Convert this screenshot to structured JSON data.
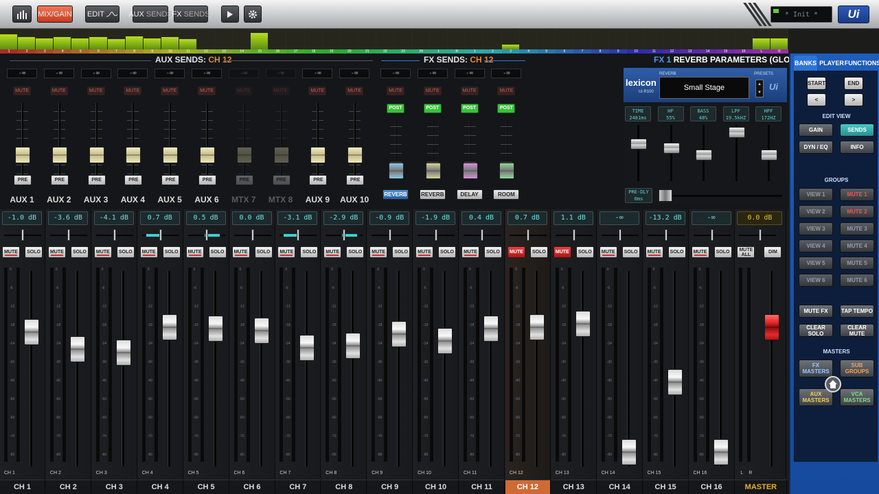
{
  "topbar": {
    "mix_gain": "MIX/GAIN",
    "edit": "EDIT",
    "aux_sends_a": "AUX",
    "aux_sends_b": "SENDS",
    "fx_sends_a": "FX",
    "fx_sends_b": "SENDS",
    "snapshot": "* Init *",
    "logo": "Ui",
    "accent": "#d9502c"
  },
  "meter_strip": {
    "numbers": [
      "1",
      "2",
      "3",
      "4",
      "5",
      "6",
      "7",
      "8",
      "9",
      "10",
      "11",
      "12",
      "13",
      "14",
      "15",
      "16",
      "17",
      "18",
      "19",
      "20",
      "21",
      "22",
      "23",
      "24",
      "L",
      "R",
      "1",
      "2",
      "3",
      "4",
      "5",
      "6",
      "7",
      "8",
      "9",
      "10",
      "11",
      "12",
      "13",
      "14",
      "15",
      "16",
      "L",
      "R"
    ],
    "levels": [
      0.75,
      0.6,
      0.55,
      0.6,
      0.55,
      0.6,
      0.5,
      0.65,
      0.55,
      0.6,
      0.5,
      0,
      0,
      0,
      0.8,
      0,
      0,
      0,
      0,
      0,
      0,
      0,
      0,
      0,
      0,
      0,
      0,
      0,
      0.25,
      0,
      0,
      0,
      0,
      0,
      0,
      0,
      0,
      0,
      0,
      0,
      0,
      0,
      0.55,
      0.55
    ]
  },
  "aux": {
    "title": "AUX SENDS:",
    "channel": "CH 12",
    "sends": [
      {
        "name": "AUX 1",
        "value": "-∞",
        "mute": "MUTE",
        "pre": "PRE",
        "level": 0.35
      },
      {
        "name": "AUX 2",
        "value": "-∞",
        "mute": "MUTE",
        "pre": "PRE",
        "level": 0.35
      },
      {
        "name": "AUX 3",
        "value": "-∞",
        "mute": "MUTE",
        "pre": "PRE",
        "level": 0.35
      },
      {
        "name": "AUX 4",
        "value": "-∞",
        "mute": "MUTE",
        "pre": "PRE",
        "level": 0.35
      },
      {
        "name": "AUX 5",
        "value": "-∞",
        "mute": "MUTE",
        "pre": "PRE",
        "level": 0.35
      },
      {
        "name": "AUX 6",
        "value": "-∞",
        "mute": "MUTE",
        "pre": "PRE",
        "level": 0.35
      },
      {
        "name": "MTX 7",
        "value": "-∞",
        "mute": "MUTE",
        "pre": "PRE",
        "level": 0.35
      },
      {
        "name": "MTX 8",
        "value": "-∞",
        "mute": "MUTE",
        "pre": "PRE",
        "level": 0.35
      },
      {
        "name": "AUX 9",
        "value": "-∞",
        "mute": "MUTE",
        "pre": "PRE",
        "level": 0.35
      },
      {
        "name": "AUX 10",
        "value": "-∞",
        "mute": "MUTE",
        "pre": "PRE",
        "level": 0.35
      }
    ]
  },
  "fx": {
    "title": "FX SENDS:",
    "channel": "CH 12",
    "sends": [
      {
        "name": "REVERB",
        "value": "-∞",
        "mute": "MUTE",
        "post": "POST",
        "color": "#8fc8e8",
        "level": 0.35
      },
      {
        "name": "REVERB",
        "value": "-∞",
        "mute": "MUTE",
        "post": "POST",
        "color": "#d8d29a",
        "level": 0.35
      },
      {
        "name": "DELAY",
        "value": "-∞",
        "mute": "MUTE",
        "post": "POST",
        "color": "#d690d8",
        "level": 0.35
      },
      {
        "name": "ROOM",
        "value": "-∞",
        "mute": "MUTE",
        "post": "POST",
        "color": "#8fd89a",
        "level": 0.35
      }
    ]
  },
  "fx_params": {
    "title_accent": "FX 1",
    "title": "REVERB PARAMETERS (GLOBAL)",
    "brand": "lexicon",
    "model": "Ui R100",
    "reverb_label": "REVERB",
    "presets_label": "PRESETS",
    "preset": "Small Stage",
    "lex_ui": "Ui",
    "params": [
      {
        "name": "TIME",
        "value": "2481ms",
        "level": 0.7
      },
      {
        "name": "HF",
        "value": "55%",
        "level": 0.6
      },
      {
        "name": "BASS",
        "value": "48%",
        "level": 0.45
      },
      {
        "name": "LPF",
        "value": "19.5kHZ",
        "level": 0.95
      },
      {
        "name": "HPF",
        "value": "172HZ",
        "level": 0.45
      }
    ],
    "predly_name": "PRE-DLY",
    "predly_value": "0ms"
  },
  "right_panel": {
    "tabs": [
      "BANKS",
      "PLAYER",
      "FUNCTIONS"
    ],
    "start": "START",
    "end": "END",
    "prev": "<",
    "next": ">",
    "edit_view_label": "EDIT VIEW",
    "gain": "GAIN",
    "sends": "SENDS",
    "dyn_eq": "DYN / EQ",
    "info": "INFO",
    "groups_label": "GROUPS",
    "views": [
      "VIEW 1",
      "VIEW 2",
      "VIEW 3",
      "VIEW 4",
      "VIEW 5",
      "VIEW 6"
    ],
    "mutes": [
      "MUTE 1",
      "MUTE 2",
      "MUTE 3",
      "MUTE 4",
      "MUTE 5",
      "MUTE 6"
    ],
    "mute_fx": "MUTE FX",
    "tap_tempo": "TAP TEMPO",
    "clear_solo": "CLEAR SOLO",
    "clear_mute": "CLEAR MUTE",
    "masters_label": "MASTERS",
    "fx_masters": "FX MASTERS",
    "sub_groups": "SUB GROUPS",
    "aux_masters": "AUX MASTERS",
    "vca_masters": "VCA MASTERS"
  },
  "channels": [
    {
      "name": "CH 1",
      "small": "CH 1",
      "gain": "-1.0 dB",
      "mute": "MUTE",
      "solo": "SOLO",
      "fader": 0.72,
      "meter": 0.0,
      "pan_cyan": 0
    },
    {
      "name": "CH 2",
      "small": "CH 2",
      "gain": "-3.6 dB",
      "mute": "MUTE",
      "solo": "SOLO",
      "fader": 0.62,
      "meter": 0.0,
      "pan_cyan": 0
    },
    {
      "name": "CH 3",
      "small": "CH 3",
      "gain": "-4.1 dB",
      "mute": "MUTE",
      "solo": "SOLO",
      "fader": 0.6,
      "meter": 0.0,
      "pan_cyan": 0
    },
    {
      "name": "CH 4",
      "small": "CH 4",
      "gain": "0.7 dB",
      "mute": "MUTE",
      "solo": "SOLO",
      "fader": 0.75,
      "meter": 0.0,
      "pan_cyan": -1
    },
    {
      "name": "CH 5",
      "small": "CH 5",
      "gain": "0.5 dB",
      "mute": "MUTE",
      "solo": "SOLO",
      "fader": 0.74,
      "meter": 0.0,
      "pan_cyan": 1
    },
    {
      "name": "CH 6",
      "small": "CH 6",
      "gain": "0.0 dB",
      "mute": "MUTE",
      "solo": "SOLO",
      "fader": 0.73,
      "meter": 0.0,
      "pan_cyan": 0
    },
    {
      "name": "CH 7",
      "small": "CH 7",
      "gain": "-3.1 dB",
      "mute": "MUTE",
      "solo": "SOLO",
      "fader": 0.63,
      "meter": 0.0,
      "pan_cyan": -1
    },
    {
      "name": "CH 8",
      "small": "CH 8",
      "gain": "-2.9 dB",
      "mute": "MUTE",
      "solo": "SOLO",
      "fader": 0.64,
      "meter": 0.0,
      "pan_cyan": 1
    },
    {
      "name": "CH 9",
      "small": "CH 9",
      "gain": "-0.9 dB",
      "mute": "MUTE",
      "solo": "SOLO",
      "fader": 0.71,
      "meter": 0.0,
      "pan_cyan": 0
    },
    {
      "name": "CH 10",
      "small": "CH 10",
      "gain": "-1.9 dB",
      "mute": "MUTE",
      "solo": "SOLO",
      "fader": 0.67,
      "meter": 0.0,
      "pan_cyan": 0
    },
    {
      "name": "CH 11",
      "small": "CH 11",
      "gain": "0.4 dB",
      "mute": "MUTE",
      "solo": "SOLO",
      "fader": 0.74,
      "meter": 0.0,
      "pan_cyan": 0
    },
    {
      "name": "CH 12",
      "small": "CH 12",
      "gain": "0.7 dB",
      "mute": "MUTE",
      "solo": "SOLO",
      "fader": 0.75,
      "meter": 0.0,
      "pan_cyan": 0,
      "muted": true,
      "selected": true
    },
    {
      "name": "CH 13",
      "small": "CH 13",
      "gain": "1.1 dB",
      "mute": "MUTE",
      "solo": "SOLO",
      "fader": 0.77,
      "meter": 0.0,
      "pan_cyan": 0,
      "muted": true
    },
    {
      "name": "CH 14",
      "small": "CH 14",
      "gain": "-∞",
      "mute": "MUTE",
      "solo": "SOLO",
      "fader": 0.02,
      "meter": 0.0,
      "pan_cyan": 0
    },
    {
      "name": "CH 15",
      "small": "CH 15",
      "gain": "-13.2 dB",
      "mute": "MUTE",
      "solo": "SOLO",
      "fader": 0.43,
      "meter": 0.0,
      "pan_cyan": 0
    },
    {
      "name": "CH 16",
      "small": "CH 16",
      "gain": "-∞",
      "mute": "MUTE",
      "solo": "SOLO",
      "fader": 0.02,
      "meter": 0.0,
      "pan_cyan": 0
    }
  ],
  "master": {
    "name": "MASTER",
    "gain": "0.0 dB",
    "mute_all": "MUTE ALL",
    "dim": "DIM",
    "l": "L",
    "r": "R",
    "fader": 0.75
  },
  "scale_labels": [
    "0",
    "-6",
    "-12",
    "-18",
    "-24",
    "-30",
    "-40",
    "-50",
    "-60",
    "-70",
    "-80"
  ]
}
